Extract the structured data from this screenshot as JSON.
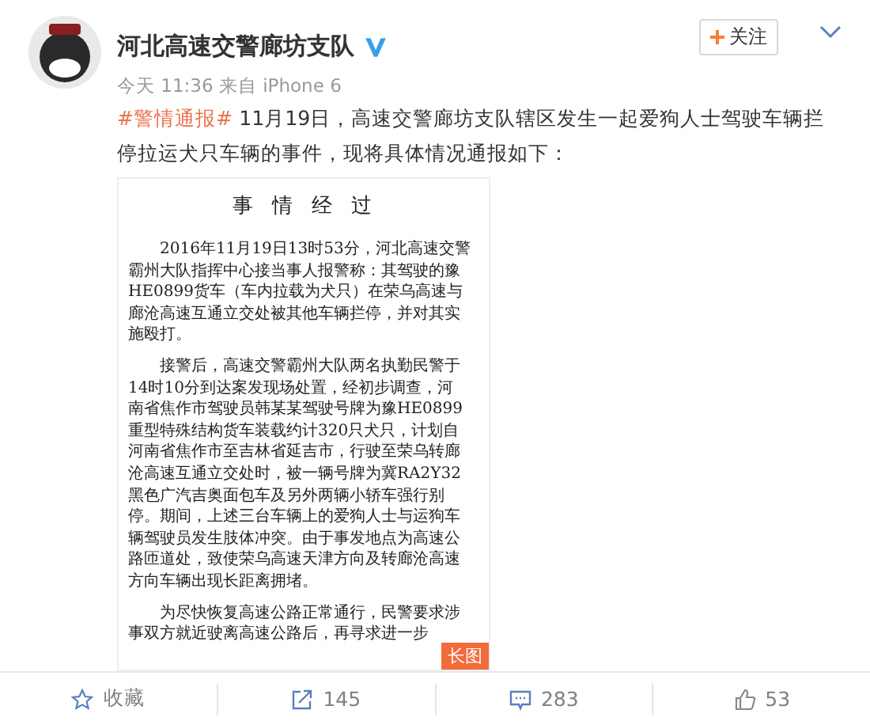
{
  "post": {
    "author": "河北高速交警廊坊支队",
    "verified": true,
    "follow_label": "关注",
    "timestamp": "今天 11:36 来自 iPhone 6",
    "hashtag": "#警情通报#",
    "text": " 11月19日，高速交警廊坊支队辖区发生一起爱狗人士驾驶车辆拦停拉运犬只车辆的事件，现将具体情况通报如下：",
    "document": {
      "title": "事 情 经 过",
      "badge": "长图",
      "paragraphs": [
        [
          "2016年11月19日13时53分，河北高速交警",
          "霸州大队指挥中心接当事人报警称：其驾驶的豫",
          "HE0899货车（车内拉载为犬只）在荣乌高速与",
          "廊沧高速互通立交处被其他车辆拦停，并对其实",
          "施殴打。"
        ],
        [
          "接警后，高速交警霸州大队两名执勤民警于",
          "14时10分到达案发现场处置，经初步调查，河",
          "南省焦作市驾驶员韩某某驾驶号牌为豫HE0899",
          "重型特殊结构货车装载约计320只犬只，计划自",
          "河南省焦作市至吉林省延吉市，行驶至荣乌转廊",
          "沧高速互通立交处时，被一辆号牌为冀RA2Y32",
          "黑色广汽吉奥面包车及另外两辆小轿车强行别",
          "停。期间，上述三台车辆上的爱狗人士与运狗车",
          "辆驾驶员发生肢体冲突。由于事发地点为高速公",
          "路匝道处，致使荣乌高速天津方向及转廊沧高速",
          "方向车辆出现长距离拥堵。"
        ],
        [
          "为尽快恢复高速公路正常通行，民警要求涉",
          "事双方就近驶离高速公路后，再寻求进一步"
        ]
      ]
    }
  },
  "actions": [
    {
      "kind": "favorite",
      "label": "收藏"
    },
    {
      "kind": "repost",
      "label": "145"
    },
    {
      "kind": "comment",
      "label": "283"
    },
    {
      "kind": "like",
      "label": "53"
    }
  ]
}
